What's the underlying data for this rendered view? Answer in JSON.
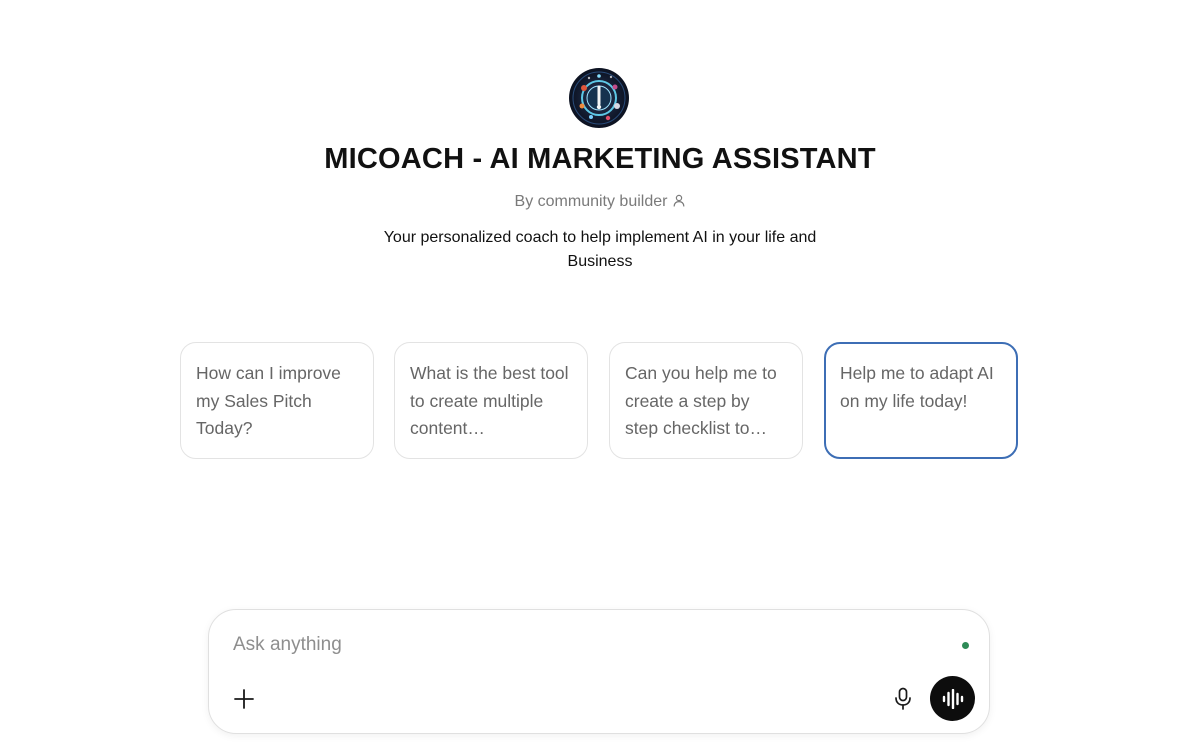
{
  "gpt": {
    "avatar_icon": "ai-logo-avatar",
    "title": "MICOACH - AI MARKETING ASSISTANT",
    "byline": "By community builder",
    "byline_icon": "person-icon",
    "description": "Your personalized coach to help implement AI in your life and Business"
  },
  "suggestions": [
    {
      "label": "How can I improve my Sales Pitch Today?"
    },
    {
      "label": "What is the best tool to create multiple content…"
    },
    {
      "label": "Can you help me to create a step by step checklist to…"
    },
    {
      "label": "Help me to adapt AI on my life today!"
    }
  ],
  "composer": {
    "placeholder": "Ask anything",
    "value": "",
    "attach_icon": "plus-icon",
    "mic_icon": "microphone-icon",
    "voice_icon": "voice-mode-icon"
  },
  "colors": {
    "active_border": "#3d6eb5",
    "status_dot": "#2e8b57",
    "voice_button_bg": "#0d0d0d"
  }
}
